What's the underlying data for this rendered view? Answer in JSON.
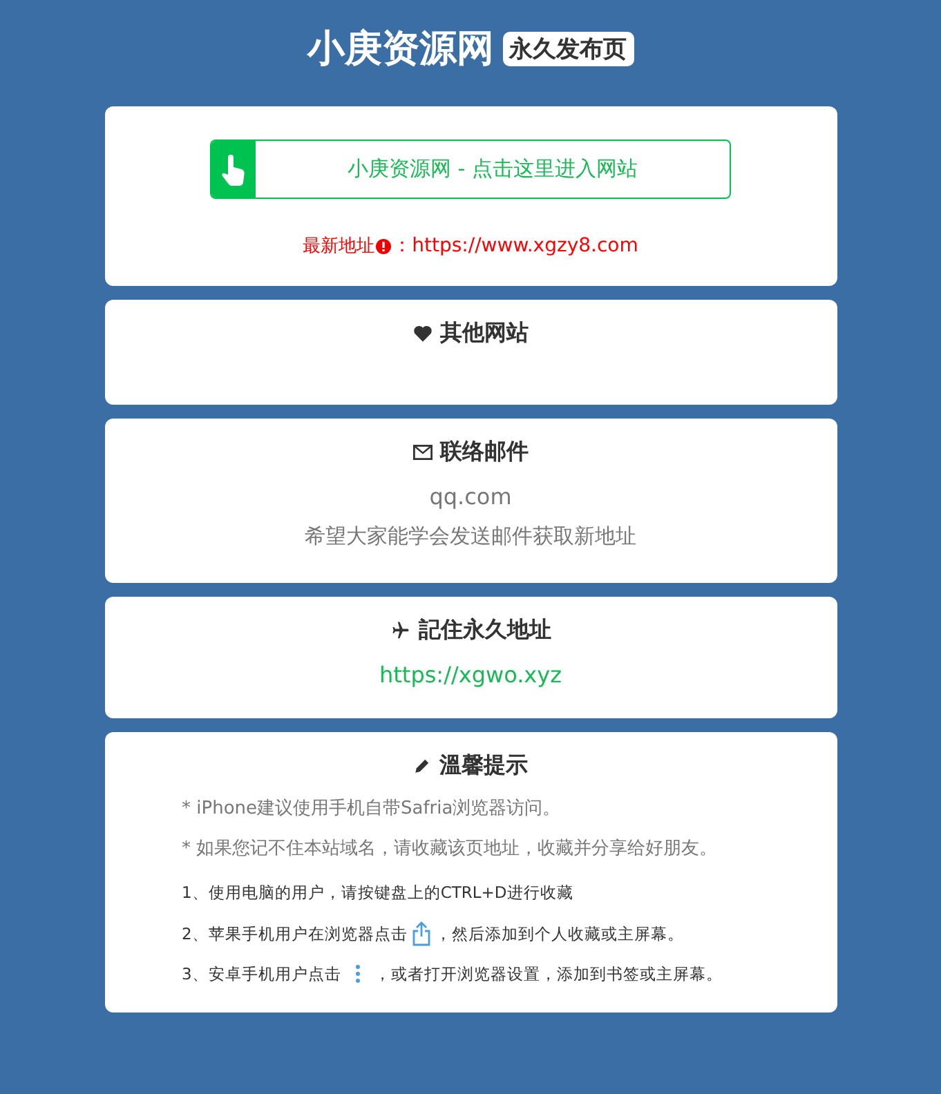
{
  "header": {
    "title": "小庚资源网",
    "badge": "永久发布页"
  },
  "entry": {
    "button": "小庚资源网 - 点击这里进入网站",
    "latest_label": "最新地址",
    "latest_value": "：https://www.xgzy8.com"
  },
  "sections": [
    {
      "kind": "links",
      "title": "其他网站"
    },
    {
      "kind": "email",
      "title": "联络邮件",
      "email": "qq.com",
      "note": "希望大家能学会发送邮件获取新地址"
    },
    {
      "kind": "address",
      "title": "記住永久地址",
      "url": "https://xgwo.xyz"
    },
    {
      "kind": "tips",
      "title": "溫馨提示",
      "notes": [
        "* iPhone建议使用手机自带Safria浏览器访问。",
        "* 如果您记不住本站域名，请收藏该页地址，收藏并分享给好朋友。"
      ],
      "steps": [
        {
          "before": "1、使用电脑的用户，请按键盘上的CTRL+D进行收藏"
        },
        {
          "before": "2、苹果手机用户在浏览器点击",
          "after": "，然后添加到个人收藏或主屏幕。"
        },
        {
          "before": "3、安卓手机用户点击",
          "after": "，或者打开浏览器设置，添加到书签或主屏幕。"
        }
      ]
    }
  ]
}
